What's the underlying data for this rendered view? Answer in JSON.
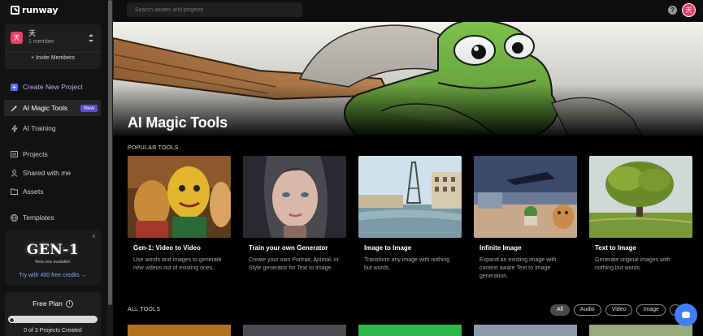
{
  "app": {
    "brand": "runway"
  },
  "team": {
    "avatar_char": "天",
    "name": "天",
    "members": "1 member",
    "invite_label": "+ Invite Members"
  },
  "nav": {
    "create_project": "Create New Project",
    "magic_tools": "AI Magic Tools",
    "new_badge": "New",
    "training": "AI Training",
    "projects": "Projects",
    "shared": "Shared with me",
    "assets": "Assets",
    "templates": "Templates"
  },
  "promo": {
    "title": "GEN-1",
    "subtitle": "Beta now available!",
    "cta": "Try with 400 free credits →",
    "close": "×"
  },
  "plan": {
    "title": "Free Plan",
    "info": "i",
    "projects_created": "0 of 3 Projects Created",
    "progress_fraction": 0
  },
  "topbar": {
    "search_placeholder": "Search assets and projects",
    "help": "?",
    "user_char": "天"
  },
  "hero": {
    "title": "AI Magic Tools"
  },
  "sections": {
    "popular": "POPULAR TOOLS",
    "all": "ALL TOOLS"
  },
  "tools": [
    {
      "title": "Gen-1: Video to Video",
      "desc": "Use words and images to generate new videos out of existing ones.",
      "icon": "puppet-image"
    },
    {
      "title": "Train your own Generator",
      "desc": "Create your own Portrait, Animal, or Style generator for Text to Image.",
      "icon": "portrait-image"
    },
    {
      "title": "Image to Image",
      "desc": "Transform any image with nothing but words.",
      "icon": "paris-image"
    },
    {
      "title": "Infinite Image",
      "desc": "Expand an existing image with context aware Text to Image generation.",
      "icon": "surreal-image"
    },
    {
      "title": "Text to Image",
      "desc": "Generate original images with nothing but words.",
      "icon": "tree-image"
    }
  ],
  "filters": [
    "All",
    "Audio",
    "Video",
    "Image"
  ],
  "colors": {
    "accent": "#5b6cf7",
    "avatar": "#e8406d",
    "chat": "#3f7fff",
    "badge": "#5b4bd6"
  }
}
